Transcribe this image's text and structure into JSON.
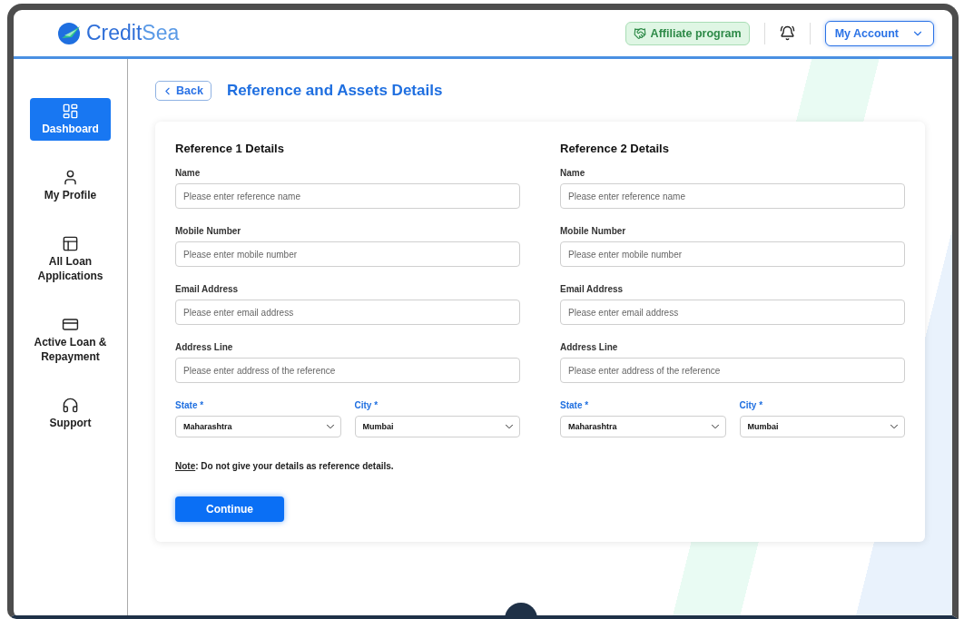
{
  "header": {
    "logo": {
      "primary": "Credit",
      "secondary": "Sea"
    },
    "affiliate_button": "Affiliate program",
    "account_button": "My Account"
  },
  "sidebar": {
    "items": [
      {
        "label": "Dashboard",
        "selected": true
      },
      {
        "label": "My Profile",
        "selected": false
      },
      {
        "label": "All Loan Applications",
        "selected": false
      },
      {
        "label": "Active Loan & Repayment",
        "selected": false
      },
      {
        "label": "Support",
        "selected": false
      }
    ]
  },
  "page": {
    "back_button": "Back",
    "title": "Reference and Assets Details"
  },
  "references": [
    {
      "title": "Reference 1 Details",
      "fields": [
        {
          "label": "Name",
          "placeholder": "Please enter reference name"
        },
        {
          "label": "Mobile Number",
          "placeholder": "Please enter mobile number"
        },
        {
          "label": "Email Address",
          "placeholder": "Please enter email address"
        },
        {
          "label": "Address Line",
          "placeholder": "Please enter address of the reference"
        }
      ],
      "selects": [
        {
          "label": "State",
          "required": "*",
          "value": "Maharashtra"
        },
        {
          "label": "City",
          "required": "*",
          "value": "Mumbai"
        }
      ]
    },
    {
      "title": "Reference 2 Details",
      "fields": [
        {
          "label": "Name",
          "placeholder": "Please enter reference name"
        },
        {
          "label": "Mobile Number",
          "placeholder": "Please enter mobile number"
        },
        {
          "label": "Email Address",
          "placeholder": "Please enter email address"
        },
        {
          "label": "Address Line",
          "placeholder": "Please enter address of the reference"
        }
      ],
      "selects": [
        {
          "label": "State",
          "required": "*",
          "value": "Maharashtra"
        },
        {
          "label": "City",
          "required": "*",
          "value": "Mumbai"
        }
      ]
    }
  ],
  "note": {
    "label": "Note",
    "text": ": Do not give your details as reference details."
  },
  "continue_button": "Continue"
}
